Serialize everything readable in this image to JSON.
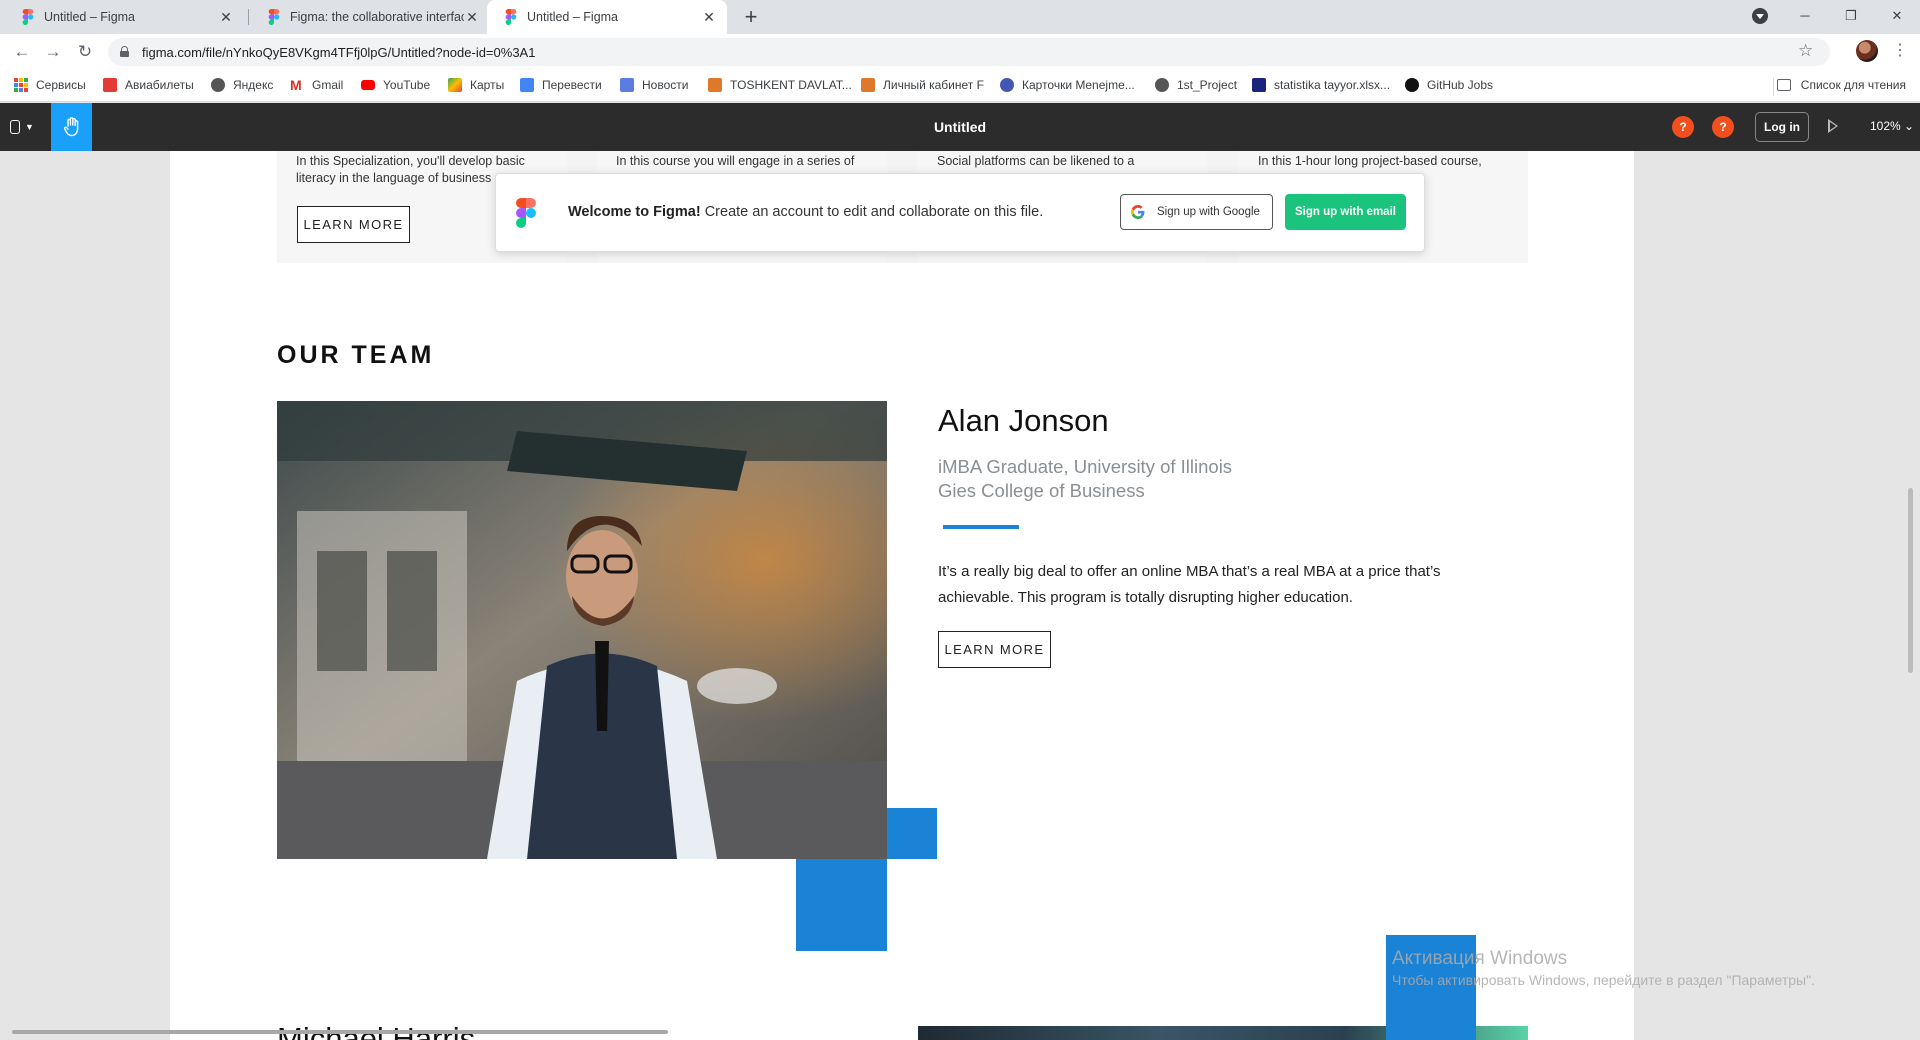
{
  "browser": {
    "tabs": [
      {
        "title": "Untitled – Figma"
      },
      {
        "title": "Figma: the collaborative interface"
      },
      {
        "title": "Untitled – Figma"
      }
    ],
    "url": "figma.com/file/nYnkoQyE8VKgm4TFfj0lpG/Untitled?node-id=0%3A1",
    "bookmarks": [
      {
        "label": "Сервисы",
        "icon": "apps-grid-icon"
      },
      {
        "label": "Авиабилеты",
        "icon": "flight-icon"
      },
      {
        "label": "Яндекс",
        "icon": "globe-icon"
      },
      {
        "label": "Gmail",
        "icon": "gmail-icon"
      },
      {
        "label": "YouTube",
        "icon": "youtube-icon"
      },
      {
        "label": "Карты",
        "icon": "maps-icon"
      },
      {
        "label": "Перевести",
        "icon": "translate-icon"
      },
      {
        "label": "Новости",
        "icon": "news-icon"
      },
      {
        "label": "TOSHKENT DAVLAT...",
        "icon": "university-icon"
      },
      {
        "label": "Личный кабинет F",
        "icon": "university-icon"
      },
      {
        "label": "Карточки Menejme...",
        "icon": "quizlet-icon"
      },
      {
        "label": "1st_Project",
        "icon": "globe-icon"
      },
      {
        "label": "statistika tayyor.xlsx...",
        "icon": "star-badge-icon"
      },
      {
        "label": "GitHub Jobs",
        "icon": "github-icon"
      }
    ],
    "reading_list": "Список для чтения"
  },
  "figma": {
    "file_title": "Untitled",
    "login_label": "Log in",
    "zoom": "102%",
    "help_label": "?"
  },
  "welcome": {
    "bold": "Welcome to Figma!",
    "text": " Create an account to edit and collaborate on this file.",
    "google_label": "Sign up with Google",
    "email_label": "Sign up with email"
  },
  "courses": [
    {
      "text": "In this Specialization, you'll develop basic literacy in the language of business"
    },
    {
      "text": "In this course you will engage in a series of"
    },
    {
      "text": "Social platforms can be likened to a"
    },
    {
      "text": "In this 1-hour long project-based course,"
    }
  ],
  "learn_more": "LEARN MORE",
  "team": {
    "heading": "OUR TEAM",
    "member": {
      "name": "Alan Jonson",
      "subtitle_line1": "iMBA Graduate, University of Illinois",
      "subtitle_line2": "Gies College of Business",
      "bio": "It’s a really big deal to offer an online MBA that’s a real MBA at a price that’s achievable. This program is totally disrupting higher education."
    },
    "next_member_name": "Michael Harris"
  },
  "watermark": {
    "line1": "Активация Windows",
    "line2": "Чтобы активировать Windows, перейдите в раздел \"Параметры\"."
  },
  "colors": {
    "accent_blue": "#1a83d6",
    "figma_toolbar": "#2c2c2c",
    "figma_hand_tool": "#18a0fb",
    "signup_green": "#1bc47d",
    "help_orange": "#f24e1e"
  }
}
